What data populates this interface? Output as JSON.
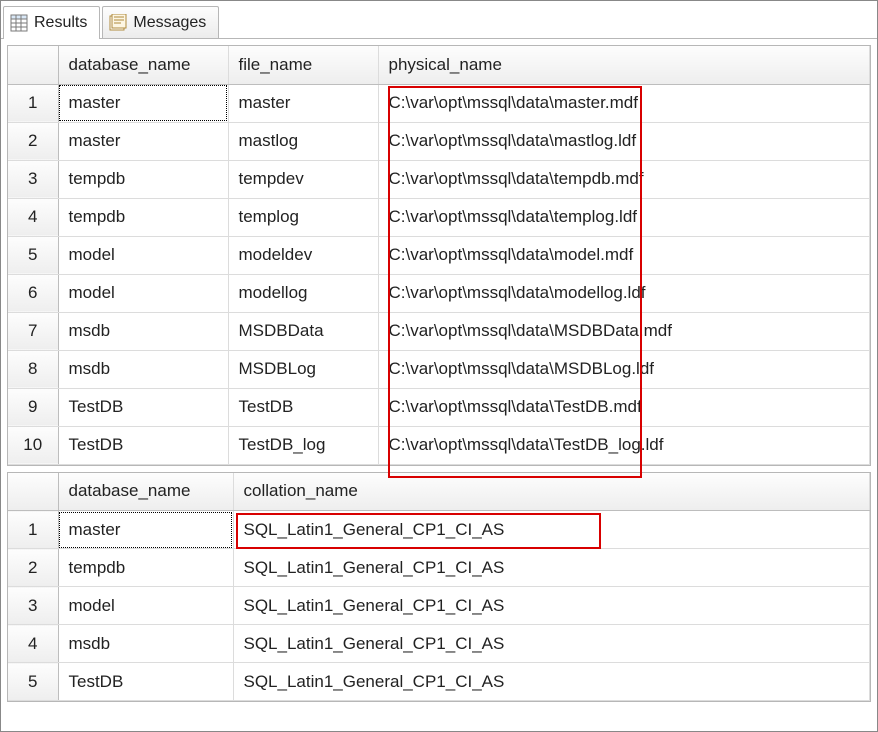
{
  "tabs": {
    "results": "Results",
    "messages": "Messages"
  },
  "table1": {
    "columns": {
      "database_name": "database_name",
      "file_name": "file_name",
      "physical_name": "physical_name"
    },
    "rows": [
      {
        "n": "1",
        "database_name": "master",
        "file_name": "master",
        "physical_name": "C:\\var\\opt\\mssql\\data\\master.mdf"
      },
      {
        "n": "2",
        "database_name": "master",
        "file_name": "mastlog",
        "physical_name": "C:\\var\\opt\\mssql\\data\\mastlog.ldf"
      },
      {
        "n": "3",
        "database_name": "tempdb",
        "file_name": "tempdev",
        "physical_name": "C:\\var\\opt\\mssql\\data\\tempdb.mdf"
      },
      {
        "n": "4",
        "database_name": "tempdb",
        "file_name": "templog",
        "physical_name": "C:\\var\\opt\\mssql\\data\\templog.ldf"
      },
      {
        "n": "5",
        "database_name": "model",
        "file_name": "modeldev",
        "physical_name": "C:\\var\\opt\\mssql\\data\\model.mdf"
      },
      {
        "n": "6",
        "database_name": "model",
        "file_name": "modellog",
        "physical_name": "C:\\var\\opt\\mssql\\data\\modellog.ldf"
      },
      {
        "n": "7",
        "database_name": "msdb",
        "file_name": "MSDBData",
        "physical_name": "C:\\var\\opt\\mssql\\data\\MSDBData.mdf"
      },
      {
        "n": "8",
        "database_name": "msdb",
        "file_name": "MSDBLog",
        "physical_name": "C:\\var\\opt\\mssql\\data\\MSDBLog.ldf"
      },
      {
        "n": "9",
        "database_name": "TestDB",
        "file_name": "TestDB",
        "physical_name": "C:\\var\\opt\\mssql\\data\\TestDB.mdf"
      },
      {
        "n": "10",
        "database_name": "TestDB",
        "file_name": "TestDB_log",
        "physical_name": "C:\\var\\opt\\mssql\\data\\TestDB_log.ldf"
      }
    ]
  },
  "table2": {
    "columns": {
      "database_name": "database_name",
      "collation_name": "collation_name"
    },
    "rows": [
      {
        "n": "1",
        "database_name": "master",
        "collation_name": "SQL_Latin1_General_CP1_CI_AS"
      },
      {
        "n": "2",
        "database_name": "tempdb",
        "collation_name": "SQL_Latin1_General_CP1_CI_AS"
      },
      {
        "n": "3",
        "database_name": "model",
        "collation_name": "SQL_Latin1_General_CP1_CI_AS"
      },
      {
        "n": "4",
        "database_name": "msdb",
        "collation_name": "SQL_Latin1_General_CP1_CI_AS"
      },
      {
        "n": "5",
        "database_name": "TestDB",
        "collation_name": "SQL_Latin1_General_CP1_CI_AS"
      }
    ]
  }
}
